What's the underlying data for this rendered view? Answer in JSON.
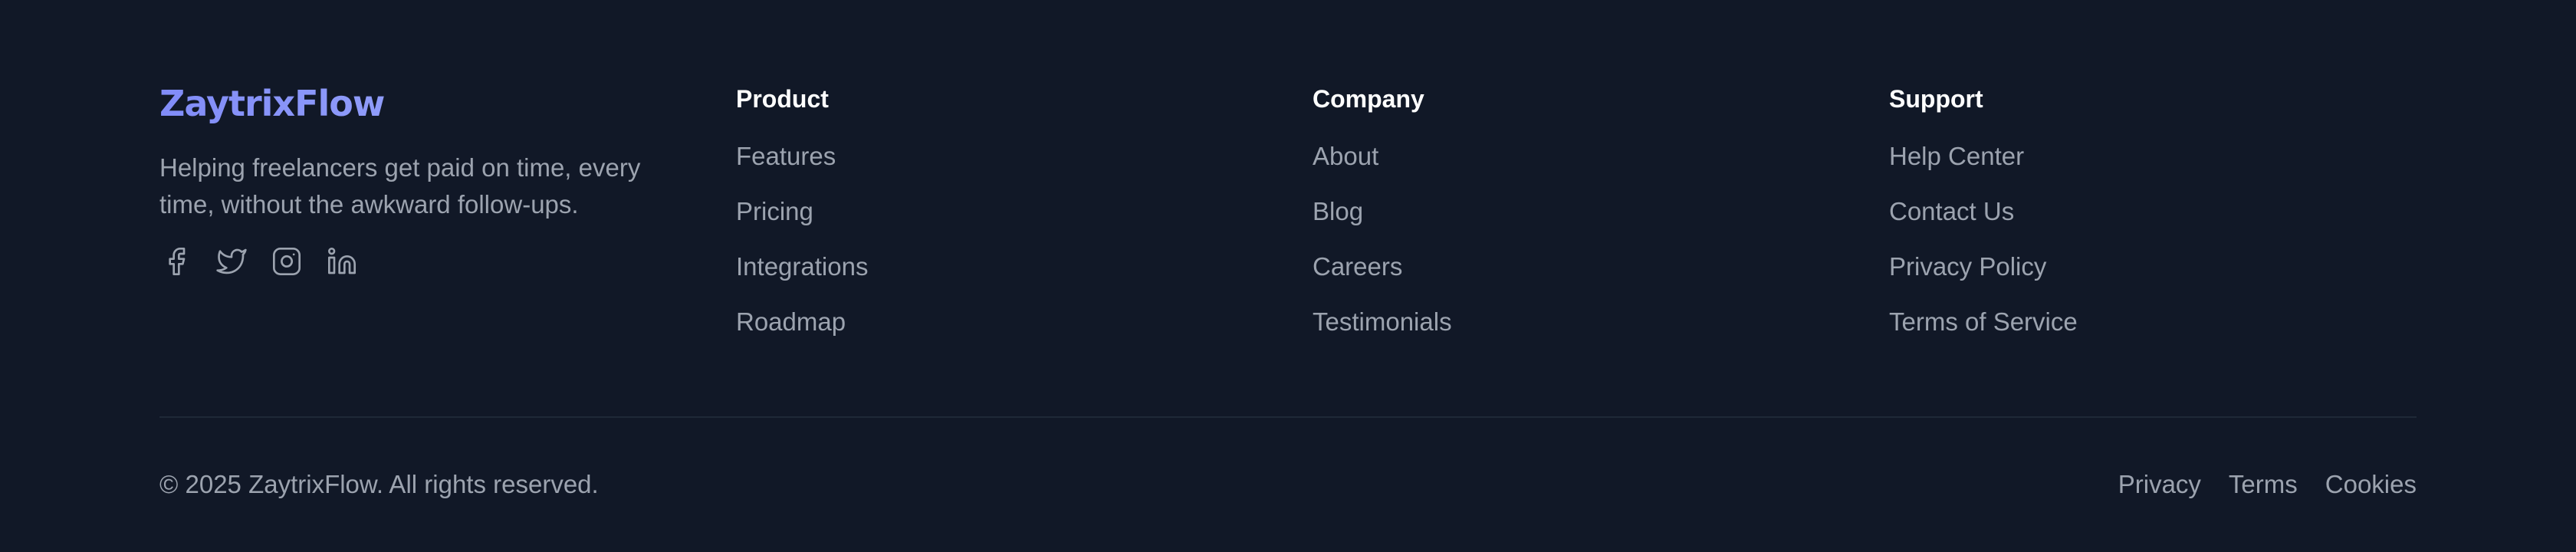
{
  "brand": {
    "name": "ZaytrixFlow",
    "tagline": "Helping freelancers get paid on time, every time, without the awkward follow-ups.",
    "socials": [
      "facebook-icon",
      "twitter-icon",
      "instagram-icon",
      "linkedin-icon"
    ]
  },
  "columns": [
    {
      "title": "Product",
      "links": [
        "Features",
        "Pricing",
        "Integrations",
        "Roadmap"
      ]
    },
    {
      "title": "Company",
      "links": [
        "About",
        "Blog",
        "Careers",
        "Testimonials"
      ]
    },
    {
      "title": "Support",
      "links": [
        "Help Center",
        "Contact Us",
        "Privacy Policy",
        "Terms of Service"
      ]
    }
  ],
  "bottom": {
    "copyright": "© 2025 ZaytrixFlow. All rights reserved.",
    "legal": [
      "Privacy",
      "Terms",
      "Cookies"
    ]
  },
  "colors": {
    "background": "#111827",
    "brand_gradient_start": "#818cf8",
    "brand_gradient_end": "#a5b4fc",
    "text_muted": "#9ca3af",
    "heading": "#ffffff",
    "divider": "#1f2937"
  }
}
